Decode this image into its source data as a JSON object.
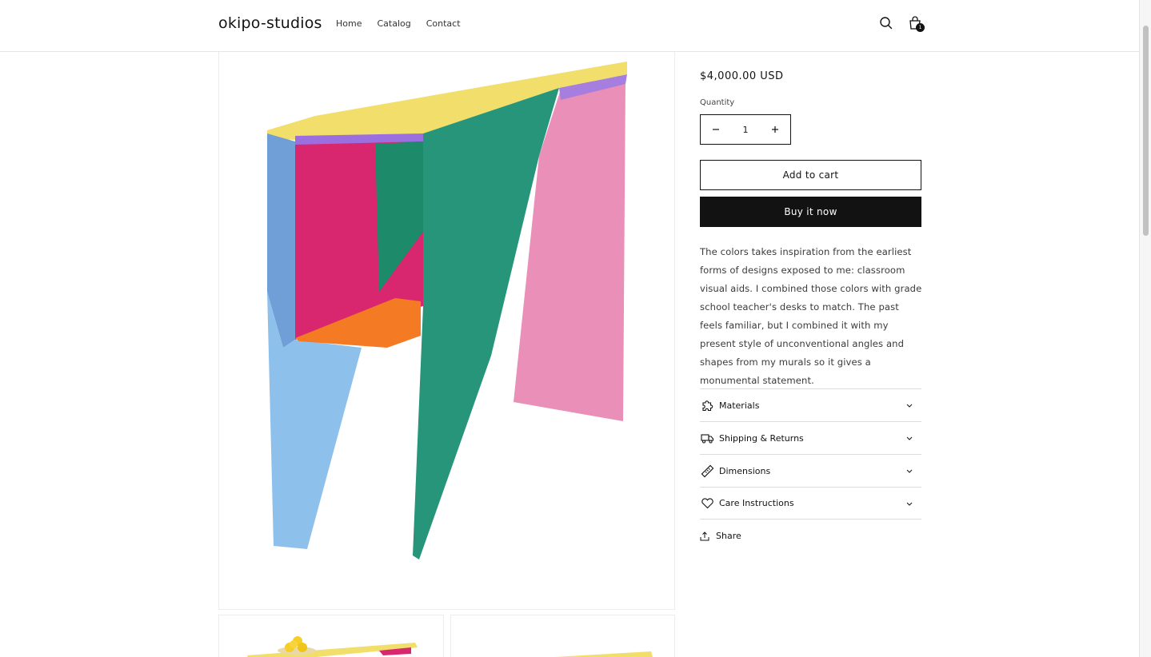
{
  "header": {
    "logo": "okipo-studios",
    "nav": [
      "Home",
      "Catalog",
      "Contact"
    ],
    "cart_count": "1",
    "icons": {
      "search": "search-icon",
      "cart": "cart-icon"
    }
  },
  "product": {
    "price": "$4,000.00 USD",
    "quantity_label": "Quantity",
    "quantity_value": "1",
    "add_to_cart": "Add to cart",
    "buy_now": "Buy it now",
    "description": "The colors takes inspiration from the earliest forms of designs exposed to me: classroom visual aids. I combined those colors with grade school teacher's desks to match. The past feels familiar, but I combined it with my present style of unconventional angles and shapes from my murals so it gives a monumental statement.",
    "accordions": [
      {
        "label": "Materials",
        "icon": "puzzle-icon"
      },
      {
        "label": "Shipping & Returns",
        "icon": "truck-icon"
      },
      {
        "label": "Dimensions",
        "icon": "ruler-icon"
      },
      {
        "label": "Care Instructions",
        "icon": "heart-icon"
      }
    ],
    "share": "Share"
  },
  "colors": {
    "text": "#121212",
    "button_dark": "#121212",
    "border": "#dcdcdc"
  }
}
